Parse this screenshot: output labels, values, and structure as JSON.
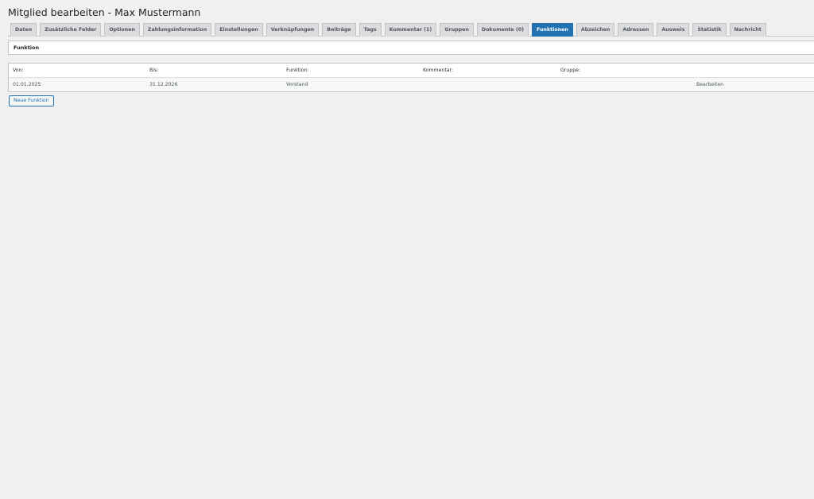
{
  "page": {
    "title": "Mitglied bearbeiten - Max Mustermann"
  },
  "tabs": [
    {
      "label": "Daten",
      "active": false
    },
    {
      "label": "Zusätzliche Felder",
      "active": false
    },
    {
      "label": "Optionen",
      "active": false
    },
    {
      "label": "Zahlungsinformation",
      "active": false
    },
    {
      "label": "Einstellungen",
      "active": false
    },
    {
      "label": "Verknüpfungen",
      "active": false
    },
    {
      "label": "Beiträge",
      "active": false
    },
    {
      "label": "Tags",
      "active": false
    },
    {
      "label": "Kommentar (1)",
      "active": false
    },
    {
      "label": "Gruppen",
      "active": false
    },
    {
      "label": "Dokumente (0)",
      "active": false
    },
    {
      "label": "Funktionen",
      "active": true
    },
    {
      "label": "Abzeichen",
      "active": false
    },
    {
      "label": "Adressen",
      "active": false
    },
    {
      "label": "Ausweis",
      "active": false
    },
    {
      "label": "Statistik",
      "active": false
    },
    {
      "label": "Nachricht",
      "active": false
    }
  ],
  "section": {
    "title": "Funktion"
  },
  "table": {
    "headers": [
      "Von:",
      "Bis:",
      "Funktion:",
      "Kommentar:",
      "Gruppe:"
    ],
    "rows": [
      {
        "von": "01.01.2025",
        "bis": "31.12.2026",
        "funktion": "Vorstand",
        "kommentar": "",
        "gruppe": "",
        "action_label": "Bearbeiten"
      }
    ]
  },
  "actions": {
    "new_function_label": "Neue Funktion"
  },
  "colors": {
    "accent": "#2271b1",
    "background": "#f0f0f1",
    "tab_inactive": "#dcdcde"
  }
}
